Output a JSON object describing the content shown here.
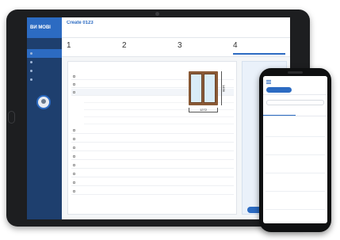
{
  "desktop": {
    "brand": "BИ MOBI",
    "page_title": "Create 0123",
    "nav": [
      "",
      "",
      "",
      ""
    ],
    "steps": [
      {
        "num": "1",
        "label": ""
      },
      {
        "num": "2",
        "label": ""
      },
      {
        "num": "3",
        "label": ""
      },
      {
        "num": "4",
        "label": ""
      }
    ],
    "card_title": "",
    "dimension_width": "1272",
    "dimension_height": "1456",
    "rows": [
      "",
      "",
      "",
      "",
      "",
      "",
      "",
      "",
      "",
      "",
      ""
    ],
    "order_button": ""
  },
  "mobile": {
    "title": "",
    "new_button": "",
    "search_placeholder": "",
    "tabs": [
      "",
      ""
    ],
    "items": [
      {
        "id": "",
        "amount": "",
        "name": "",
        "addr": ""
      },
      {
        "id": "",
        "amount": "",
        "name": "",
        "addr": ""
      },
      {
        "id": "",
        "amount": "",
        "name": "",
        "addr": ""
      },
      {
        "id": "",
        "amount": "",
        "name": "",
        "addr": ""
      },
      {
        "id": "",
        "amount": "",
        "name": "",
        "addr": ""
      }
    ]
  },
  "colors": {
    "brand_blue": "#2c6bc2",
    "sidebar_navy": "#1e3f6e",
    "device_frame": "#1d1e20",
    "window_frame": "#8a5a36"
  }
}
